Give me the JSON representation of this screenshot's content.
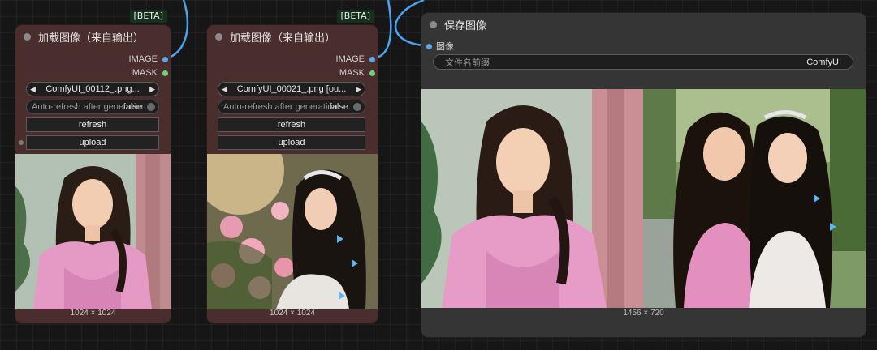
{
  "load_nodes": [
    {
      "badge": "[BETA]",
      "title": "加载图像（来自输出）",
      "outputs": {
        "image_label": "IMAGE",
        "mask_label": "MASK"
      },
      "image_combo": {
        "prev": "◀",
        "value": "ComfyUI_00112_.png...",
        "next": "▶"
      },
      "auto_refresh": {
        "label": "Auto-refresh after generation",
        "value": "false"
      },
      "refresh_label": "refresh",
      "upload_label": "upload",
      "dimensions": "1024 × 1024"
    },
    {
      "badge": "[BETA]",
      "title": "加载图像（来自输出）",
      "outputs": {
        "image_label": "IMAGE",
        "mask_label": "MASK"
      },
      "image_combo": {
        "prev": "◀",
        "value": "ComfyUI_00021_.png [ou...",
        "next": "▶"
      },
      "auto_refresh": {
        "label": "Auto-refresh after generation",
        "value": "false"
      },
      "refresh_label": "refresh",
      "upload_label": "upload",
      "dimensions": "1024 × 1024"
    }
  ],
  "save_node": {
    "title": "保存图像",
    "input_label": "图像",
    "filename_prefix": {
      "label": "文件名前缀",
      "value": "ComfyUI"
    },
    "dimensions": "1456 × 720"
  },
  "colors": {
    "image_slot": "#5fa8e8",
    "mask_slot": "#6ed47a",
    "wire": "#4aa3ee",
    "load_node_bg": "#4a2d2d",
    "save_node_bg": "#353535"
  },
  "icons": [
    "node-collapse-dot-icon",
    "combo-left-arrow-icon",
    "combo-right-arrow-icon",
    "toggle-knob-icon"
  ]
}
